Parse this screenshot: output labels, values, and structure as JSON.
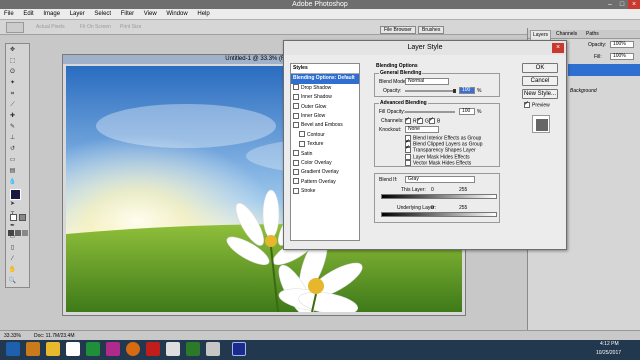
{
  "app": {
    "title": "Adobe Photoshop"
  },
  "menu": [
    "File",
    "Edit",
    "Image",
    "Layer",
    "Select",
    "Filter",
    "View",
    "Window",
    "Help"
  ],
  "options": {
    "actual_pixels": "Actual Pixels",
    "fit_on_screen": "Fit On Screen",
    "print_size": "Print Size"
  },
  "palette_tabs": {
    "file_browser": "File Browser",
    "brushes": "Brushes"
  },
  "document": {
    "title": "Untitled-1 @ 33.3% (Right, R"
  },
  "status": {
    "zoom": "33.33%",
    "doc": "Doc: 11.7M/23.4M"
  },
  "dialog": {
    "title": "Layer Style",
    "styles_header": "Styles",
    "styles": [
      {
        "label": "Blending Options: Default",
        "selected": true,
        "check": false
      },
      {
        "label": "Drop Shadow",
        "check": true
      },
      {
        "label": "Inner Shadow",
        "check": true
      },
      {
        "label": "Outer Glow",
        "check": true
      },
      {
        "label": "Inner Glow",
        "check": true
      },
      {
        "label": "Bevel and Emboss",
        "check": true
      },
      {
        "label": "Contour",
        "check": true,
        "indent": true
      },
      {
        "label": "Texture",
        "check": true,
        "indent": true
      },
      {
        "label": "Satin",
        "check": true
      },
      {
        "label": "Color Overlay",
        "check": true
      },
      {
        "label": "Gradient Overlay",
        "check": true
      },
      {
        "label": "Pattern Overlay",
        "check": true
      },
      {
        "label": "Stroke",
        "check": true
      }
    ],
    "blending_options": "Blending Options",
    "general_blending": "General Blending",
    "blend_mode_label": "Blend Mode:",
    "blend_mode_value": "Normal",
    "opacity_label": "Opacity:",
    "opacity_value": "100",
    "percent": "%",
    "advanced_blending": "Advanced Blending",
    "fill_opacity_label": "Fill Opacity:",
    "fill_opacity_value": "100",
    "channels_label": "Channels:",
    "channels": [
      "R",
      "G",
      "B"
    ],
    "knockout_label": "Knockout:",
    "knockout_value": "None",
    "adv_checks": [
      {
        "label": "Blend Interior Effects as Group",
        "checked": false
      },
      {
        "label": "Blend Clipped Layers as Group",
        "checked": true
      },
      {
        "label": "Transparency Shapes Layer",
        "checked": true
      },
      {
        "label": "Layer Mask Hides Effects",
        "checked": false
      },
      {
        "label": "Vector Mask Hides Effects",
        "checked": false
      }
    ],
    "blend_if_label": "Blend If:",
    "blend_if_value": "Gray",
    "this_layer_label": "This Layer:",
    "underlying_layer_label": "Underlying Layer:",
    "range_min": "0",
    "range_max": "255",
    "ok": "OK",
    "cancel": "Cancel",
    "new_style": "New Style...",
    "preview": "Preview"
  },
  "layers_panel": {
    "tabs": [
      "Layers",
      "Channels",
      "Paths"
    ],
    "opacity_label": "Opacity:",
    "opacity_value": "100%",
    "fill_label": "Fill:",
    "fill_value": "100%",
    "background_label": "Background"
  },
  "clock": {
    "time": "4:12 PM",
    "date": "10/25/2017"
  },
  "colors": {
    "titlebar": "#6e6e6e",
    "taskbar": "#22384f",
    "selected": "#2f6fd0"
  }
}
